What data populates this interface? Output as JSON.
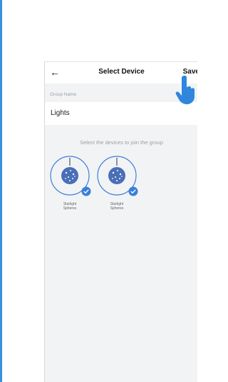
{
  "header": {
    "back_icon": "arrow-left-icon",
    "title": "Select Device",
    "save_label": "Save"
  },
  "group": {
    "label": "Group Name",
    "value": "Lights"
  },
  "hint": "Select the devices to join the group",
  "devices": [
    {
      "name_line1": "Starlight",
      "name_line2": "Spheres",
      "icon": "starlight-sphere-icon",
      "selected": true
    },
    {
      "name_line1": "Starlight",
      "name_line2": "Spheres",
      "icon": "starlight-sphere-icon",
      "selected": true
    }
  ],
  "colors": {
    "accent": "#3b7fd9",
    "sphere": "#4a6fb8",
    "background": "#f2f3f5"
  },
  "overlay": {
    "icon": "pointing-hand-icon"
  }
}
